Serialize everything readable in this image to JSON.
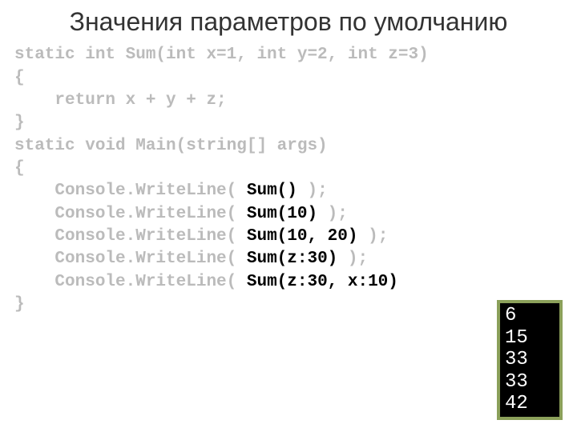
{
  "title": "Значения параметров по умолчанию",
  "code": {
    "line1": "static int Sum(int x=1, int y=2, int z=3)",
    "line2": "{",
    "line3": "    return x + y + z;",
    "line4": "}",
    "line5": "static void Main(string[] args)",
    "line6": "{",
    "line7_pre": "    Console.WriteLine( ",
    "call1": "Sum()",
    "line7_post": " );",
    "call2": "Sum(10)",
    "call3": "Sum(10, 20)",
    "call4": "Sum(z:30)",
    "call5": "Sum(z:30, x:10)",
    "line12": "}"
  },
  "output": {
    "v1": "6",
    "v2": "15",
    "v3": "33",
    "v4": "33",
    "v5": "42"
  }
}
